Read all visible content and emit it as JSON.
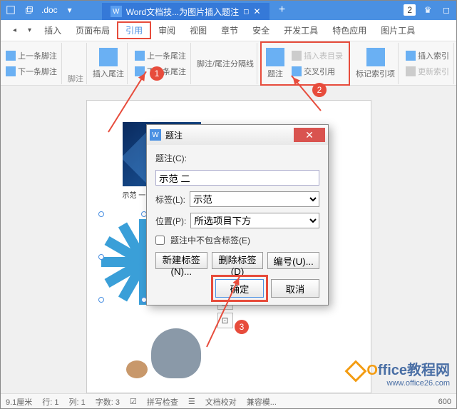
{
  "titlebar": {
    "doc_title": "Word文档技...为图片插入题注",
    "badge": "2",
    "left_label": ".doc"
  },
  "menubar": {
    "items": [
      "插入",
      "页面布局",
      "引用",
      "审阅",
      "视图",
      "章节",
      "安全",
      "开发工具",
      "特色应用",
      "图片工具"
    ]
  },
  "ribbon": {
    "prev_foot": "上一条脚注",
    "next_foot": "下一条脚注",
    "footnote_group": "脚注",
    "insert_endnote": "插入尾注",
    "prev_end": "上一条尾注",
    "next_end": "下一条尾注",
    "sep_line": "脚注/尾注分隔线",
    "caption_big": "题注",
    "insert_toc": "插入表目录",
    "cross_ref": "交叉引用",
    "mark_index": "标记索引项",
    "insert_index": "插入索引",
    "update_index": "更新索引"
  },
  "dialog": {
    "title": "题注",
    "caption_label": "题注(C):",
    "caption_value": "示范 二",
    "label_label": "标签(L):",
    "label_value": "示范",
    "position_label": "位置(P):",
    "position_value": "所选项目下方",
    "exclude_label": "题注中不包含标签(E)",
    "new_label_btn": "新建标签(N)...",
    "del_label_btn": "删除标签(D)",
    "numbering_btn": "编号(U)...",
    "ok": "确定",
    "cancel": "取消"
  },
  "doc": {
    "caption1": "示范 一"
  },
  "statusbar": {
    "page": "9.1厘米",
    "line": "行: 1",
    "col": "列: 1",
    "wordcount": "字数: 3",
    "spellcheck": "拼写检查",
    "doccheck": "文档校对",
    "compat": "兼容模...",
    "zoom": "600"
  },
  "watermark": {
    "brand": "Office",
    "brand_suffix": "教程网",
    "url": "www.office26.com"
  },
  "markers": {
    "m1": "1",
    "m2": "2",
    "m3": "3"
  }
}
